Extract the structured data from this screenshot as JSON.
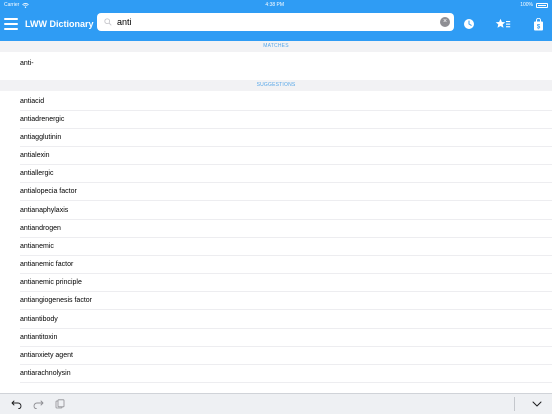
{
  "status": {
    "carrier": "Carrier",
    "time": "4:38 PM",
    "battery": "100%"
  },
  "navbar": {
    "title": "LWW Dictionary",
    "search_value": "anti",
    "icons": [
      "menu-icon",
      "history-icon",
      "favorites-icon",
      "shop-icon"
    ]
  },
  "sections": {
    "matches_label": "MATCHES",
    "suggestions_label": "SUGGESTIONS"
  },
  "matches": [
    "anti-"
  ],
  "suggestions": [
    "antiacid",
    "antiadrenergic",
    "antiagglutinin",
    "antialexin",
    "antiallergic",
    "antialopecia factor",
    "antianaphylaxis",
    "antiandrogen",
    "antianemic",
    "antianemic factor",
    "antianemic principle",
    "antiangiogenesis factor",
    "antiantibody",
    "antiantitoxin",
    "antianxiety agent",
    "antiarachnolysin"
  ],
  "toolbar": {
    "icons": [
      "undo-icon",
      "redo-icon",
      "paste-icon",
      "dismiss-keyboard-icon"
    ]
  },
  "colors": {
    "accent": "#2f9cf4",
    "section_text": "#55a6e8"
  }
}
